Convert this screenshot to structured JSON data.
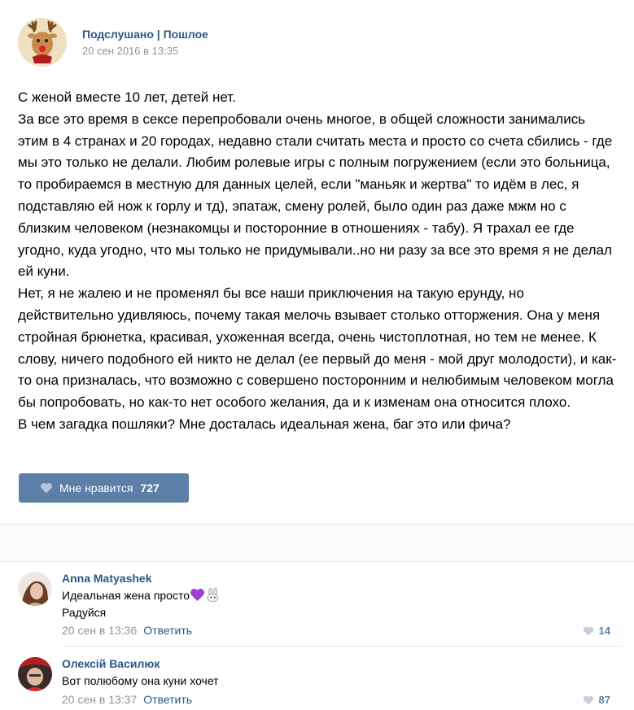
{
  "post": {
    "author": "Подслушано | Пошлое",
    "date": "20 сен 2016 в 13:35",
    "paragraphs": [
      "С женой вместе 10 лет, детей нет.",
      "За все это время в сексе перепробовали очень многое, в общей сложности занимались этим в 4 странах и 20 городах, недавно стали считать места и просто со счета сбились - где мы это только не делали. Любим ролевые игры с полным погружением (если это больница, то пробираемся в местную для данных целей, если \"маньяк и жертва\" то идём в лес, я подставляю ей нож к горлу и тд), эпатаж, смену ролей, было один раз даже мжм но с близким человеком (незнакомцы и посторонние в отношениях - табу). Я трахал ее где угодно, куда угодно, что мы только не придумывали..но ни разу за все это время я не делал ей куни.",
      "Нет, я не жалею и не променял бы все наши приключения на такую ерунду, но действительно удивляюсь, почему такая мелочь взывает столько отторжения. Она у меня стройная брюнетка, красивая, ухоженная всегда, очень чистоплотная, но тем не менее. К слову, ничего подобного ей никто не делал (ее первый до меня - мой друг молодости), и как-то она призналась, что возможно с совершено посторонним и нелюбимым человеком могла бы попробовать, но как-то нет особого желания, да и к изменам она относится плохо.",
      "В чем загадка пошляки? Мне досталась идеальная жена, баг это или фича?"
    ],
    "like_label": "Мне нравится",
    "like_count": "727"
  },
  "comments": [
    {
      "author": "Anna Matyashek",
      "line1": "Идеальная жена просто",
      "line2": "Радуйся",
      "date": "20 сен в 13:36",
      "reply": "Ответить",
      "likes": "14"
    },
    {
      "author": "Олексій Василюк",
      "line1": "Вот полюбому она куни хочет",
      "date": "20 сен в 13:37",
      "reply": "Ответить",
      "likes": "87"
    }
  ],
  "colors": {
    "link": "#2a5885",
    "like_button": "#5b7fa6",
    "muted": "#939393"
  }
}
